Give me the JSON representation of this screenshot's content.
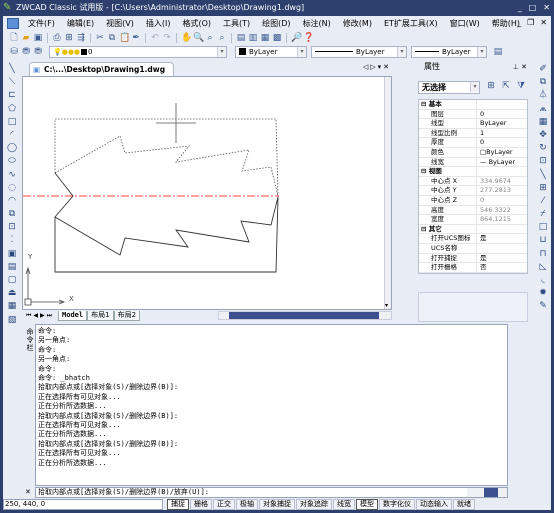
{
  "titlebar": {
    "title": "ZWCAD Classic 试用版 - [C:\\Users\\Administrator\\Desktop\\Drawing1.dwg]",
    "min": "_",
    "max": "□",
    "close": "✕"
  },
  "menu": [
    "文件(F)",
    "编辑(E)",
    "视图(V)",
    "插入(I)",
    "格式(O)",
    "工具(T)",
    "绘图(D)",
    "标注(N)",
    "修改(M)",
    "ET扩展工具(X)",
    "窗口(W)",
    "帮助(H)"
  ],
  "layer_combo": {
    "value": "0"
  },
  "color_combo": {
    "value": "ByLayer"
  },
  "linetype_combo": {
    "value": "ByLayer"
  },
  "lineweight_combo": {
    "value": "ByLayer"
  },
  "document_tab": {
    "label": "C:\\...\\Desktop\\Drawing1.dwg"
  },
  "layout_tabs": [
    "Model",
    "布局1",
    "布局2"
  ],
  "ucs": {
    "x": "X",
    "y": "Y"
  },
  "properties": {
    "title": "属性",
    "selection": "无选择",
    "groups": [
      {
        "name": "基本",
        "rows": [
          [
            "图层",
            "0"
          ],
          [
            "线型",
            "ByLayer"
          ],
          [
            "线型比例",
            "1"
          ],
          [
            "厚度",
            "0"
          ],
          [
            "颜色",
            "□ByLayer"
          ],
          [
            "线宽",
            "— ByLayer"
          ]
        ]
      },
      {
        "name": "视图",
        "rows": [
          [
            "中心点 X",
            "334.9674"
          ],
          [
            "中心点 Y",
            "277.2813"
          ],
          [
            "中心点 Z",
            "0"
          ],
          [
            "高度",
            "546.3322"
          ],
          [
            "宽度",
            "864.1215"
          ]
        ]
      },
      {
        "name": "其它",
        "rows": [
          [
            "打开UCS图标",
            "是"
          ],
          [
            "UCS名称",
            ""
          ],
          [
            "打开捕捉",
            "是"
          ],
          [
            "打开栅格",
            "否"
          ]
        ]
      }
    ]
  },
  "command": {
    "label": "命令栏",
    "history": [
      "命令:",
      "另一角点:",
      "命令:",
      "另一角点:",
      "命令:",
      "命令: _bhatch",
      "拾取内部点或[选择对象(S)/删除边界(B)]:",
      "正在选择所有可见对象...",
      "正在分析所选数据...",
      "拾取内部点或[选择对象(S)/删除边界(B)]:",
      "正在选择所有可见对象...",
      "正在分析所选数据...",
      "拾取内部点或[选择对象(S)/删除边界(B)]:",
      "正在选择所有可见对象...",
      "正在分析所选数据..."
    ],
    "prompt": "拾取内部点或[选择对象(S)/删除边界(B)/放弃(U)]:"
  },
  "status": {
    "coords": "250, 440, 0",
    "buttons": [
      {
        "label": "捕捉",
        "on": true
      },
      {
        "label": "栅格",
        "on": false
      },
      {
        "label": "正交",
        "on": false
      },
      {
        "label": "极轴",
        "on": false
      },
      {
        "label": "对象捕捉",
        "on": false
      },
      {
        "label": "对象追踪",
        "on": false
      },
      {
        "label": "线宽",
        "on": false
      },
      {
        "label": "模型",
        "on": true
      },
      {
        "label": "数字化仪",
        "on": false
      },
      {
        "label": "动态输入",
        "on": false
      },
      {
        "label": "就绪",
        "on": false
      }
    ]
  },
  "colors": {
    "frame": "#2d3f6c",
    "background": "#e8ecf4",
    "centerline": "#ff4040"
  }
}
